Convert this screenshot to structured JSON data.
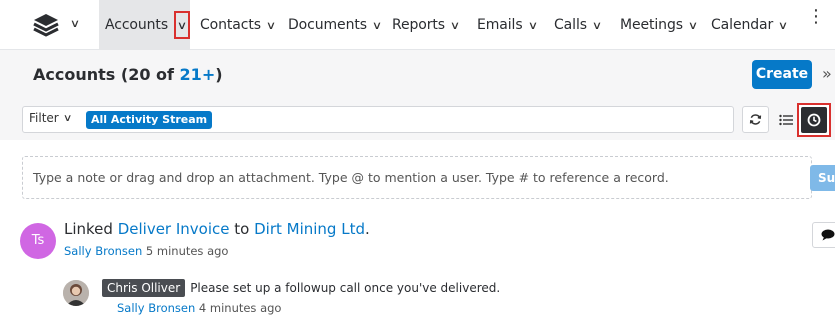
{
  "nav": {
    "items": [
      {
        "label": "Accounts"
      },
      {
        "label": "Contacts"
      },
      {
        "label": "Documents"
      },
      {
        "label": "Reports"
      },
      {
        "label": "Emails"
      },
      {
        "label": "Calls"
      },
      {
        "label": "Meetings"
      },
      {
        "label": "Calendar"
      }
    ],
    "active": "Accounts",
    "more_icon": "kebab-icon",
    "highlight_color": "#d9302e"
  },
  "header": {
    "title": "Accounts",
    "count_prefix": " (",
    "count_text": "20 of ",
    "count_link": "21+",
    "count_suffix": ")",
    "create_label": "Create",
    "collapse_icon": "double-chevron-right-icon"
  },
  "filter": {
    "label": "Filter",
    "pill": "All Activity Stream"
  },
  "composer": {
    "placeholder": "Type a note or drag and drop an attachment. Type @ to mention a user. Type # to reference a record.",
    "submit_label": "Submit"
  },
  "activity": {
    "avatar_initials": "Ts",
    "avatar_color": "#d067e3",
    "prefix": "Linked ",
    "record": "Deliver Invoice",
    "middle": " to ",
    "parent": "Dirt Mining Ltd",
    "suffix": ".",
    "author": "Sally Bronsen",
    "time": " 5 minutes ago"
  },
  "comment": {
    "mention": "Chris Olliver",
    "text": "Please set up a followup call once you've  delivered.",
    "author": "Sally Bronsen",
    "time": " 4 minutes ago"
  },
  "colors": {
    "primary": "#0679c8",
    "dark": "#2b2d31"
  }
}
